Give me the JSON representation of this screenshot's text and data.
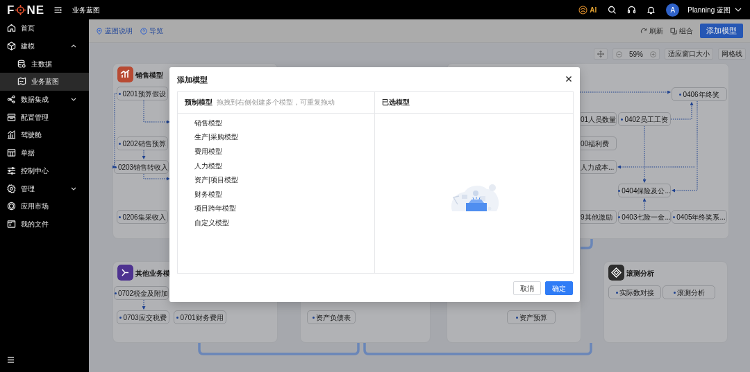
{
  "topbar": {
    "logo": {
      "left": "F",
      "right": "NE"
    },
    "breadcrumb": "业务蓝图",
    "ai_label": "AI",
    "avatar": "A",
    "user": "Planning 蓝图"
  },
  "sidebar": {
    "items": [
      {
        "label": "首页",
        "selected": false
      },
      {
        "label": "建模",
        "selected": false,
        "expanded": true,
        "children": [
          {
            "label": "主数据",
            "selected": false
          },
          {
            "label": "业务蓝图",
            "selected": true
          }
        ]
      },
      {
        "label": "数据集成",
        "selected": false,
        "expanded": false
      },
      {
        "label": "配置管理",
        "selected": false
      },
      {
        "label": "驾驶舱",
        "selected": false
      },
      {
        "label": "单据",
        "selected": false
      },
      {
        "label": "控制中心",
        "selected": false
      },
      {
        "label": "管理",
        "selected": false,
        "expanded": false
      },
      {
        "label": "应用市场",
        "selected": false
      },
      {
        "label": "我的文件",
        "selected": false
      }
    ]
  },
  "toolbar": {
    "links": [
      "蓝图说明",
      "导览"
    ],
    "actions": [
      "刷新",
      "组合"
    ],
    "primary_button": "添加模型"
  },
  "zoom": {
    "value": "59%",
    "view_buttons": [
      "适应窗口大小",
      "网格线"
    ]
  },
  "canvas": {
    "cards": [
      {
        "title": "销售模型",
        "color": "#b84a33",
        "nodes": [
          "0201预算假设",
          "0202销售预算",
          "0203销售转收入",
          "0206集采收入"
        ]
      },
      {
        "nodes": [
          "0406年终奖",
          "01人员数量",
          "0402员工工资",
          "00福利费",
          "人力成本...",
          "0404保险及公...",
          "9其他激励",
          "0403七险一金...",
          "0405年终奖系..."
        ]
      },
      {
        "title": "其他业务模",
        "color": "#4e3290",
        "nodes": [
          "0702税金及附加",
          "0703应交税费",
          "0701财务费用"
        ]
      },
      {
        "nodes": [
          "资产负债表"
        ]
      },
      {
        "nodes": [
          "资产预算"
        ]
      },
      {
        "title": "滚测分析",
        "color": "#2e2e2e",
        "nodes": [
          "实际数对接",
          "滚测分析"
        ]
      }
    ]
  },
  "modal": {
    "title": "添加模型",
    "presets": {
      "heading": "预制模型",
      "hint": "拖拽到右侧创建多个模型，可重复拖动",
      "items": [
        "销售模型",
        "生产|采购模型",
        "费用模型",
        "人力模型",
        "资产|项目模型",
        "财务模型",
        "项目跨年模型",
        "自定义模型"
      ]
    },
    "selected_panel": {
      "heading": "已选模型"
    },
    "buttons": [
      {
        "label": "取消",
        "kind": "secondary"
      },
      {
        "label": "确定",
        "kind": "primary"
      }
    ]
  }
}
